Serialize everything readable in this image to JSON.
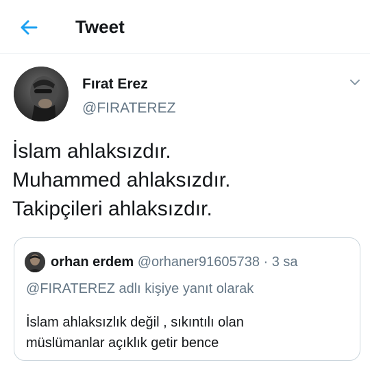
{
  "header": {
    "title": "Tweet",
    "back_icon": "arrow-left-icon"
  },
  "colors": {
    "accent": "#1da1f2",
    "text_primary": "#14171a",
    "text_secondary": "#657786",
    "border": "#ccd6dd"
  },
  "tweet": {
    "author": {
      "name": "Fırat Erez",
      "handle": "@FIRATEREZ"
    },
    "menu_icon": "chevron-down-icon",
    "lines": [
      "İslam ahlaksızdır.",
      "Muhammed ahlaksızdır.",
      "Takipçileri ahlaksızdır."
    ]
  },
  "quoted_tweet": {
    "author": {
      "name": "orhan erdem",
      "handle": "@orhaner91605738"
    },
    "separator": "·",
    "time": "3 sa",
    "reply_to": "@FIRATEREZ adlı kişiye yanıt olarak",
    "lines": [
      "İslam ahlaksızlık değil , sıkıntılı olan",
      "müslümanlar açıklık getir bence"
    ]
  }
}
